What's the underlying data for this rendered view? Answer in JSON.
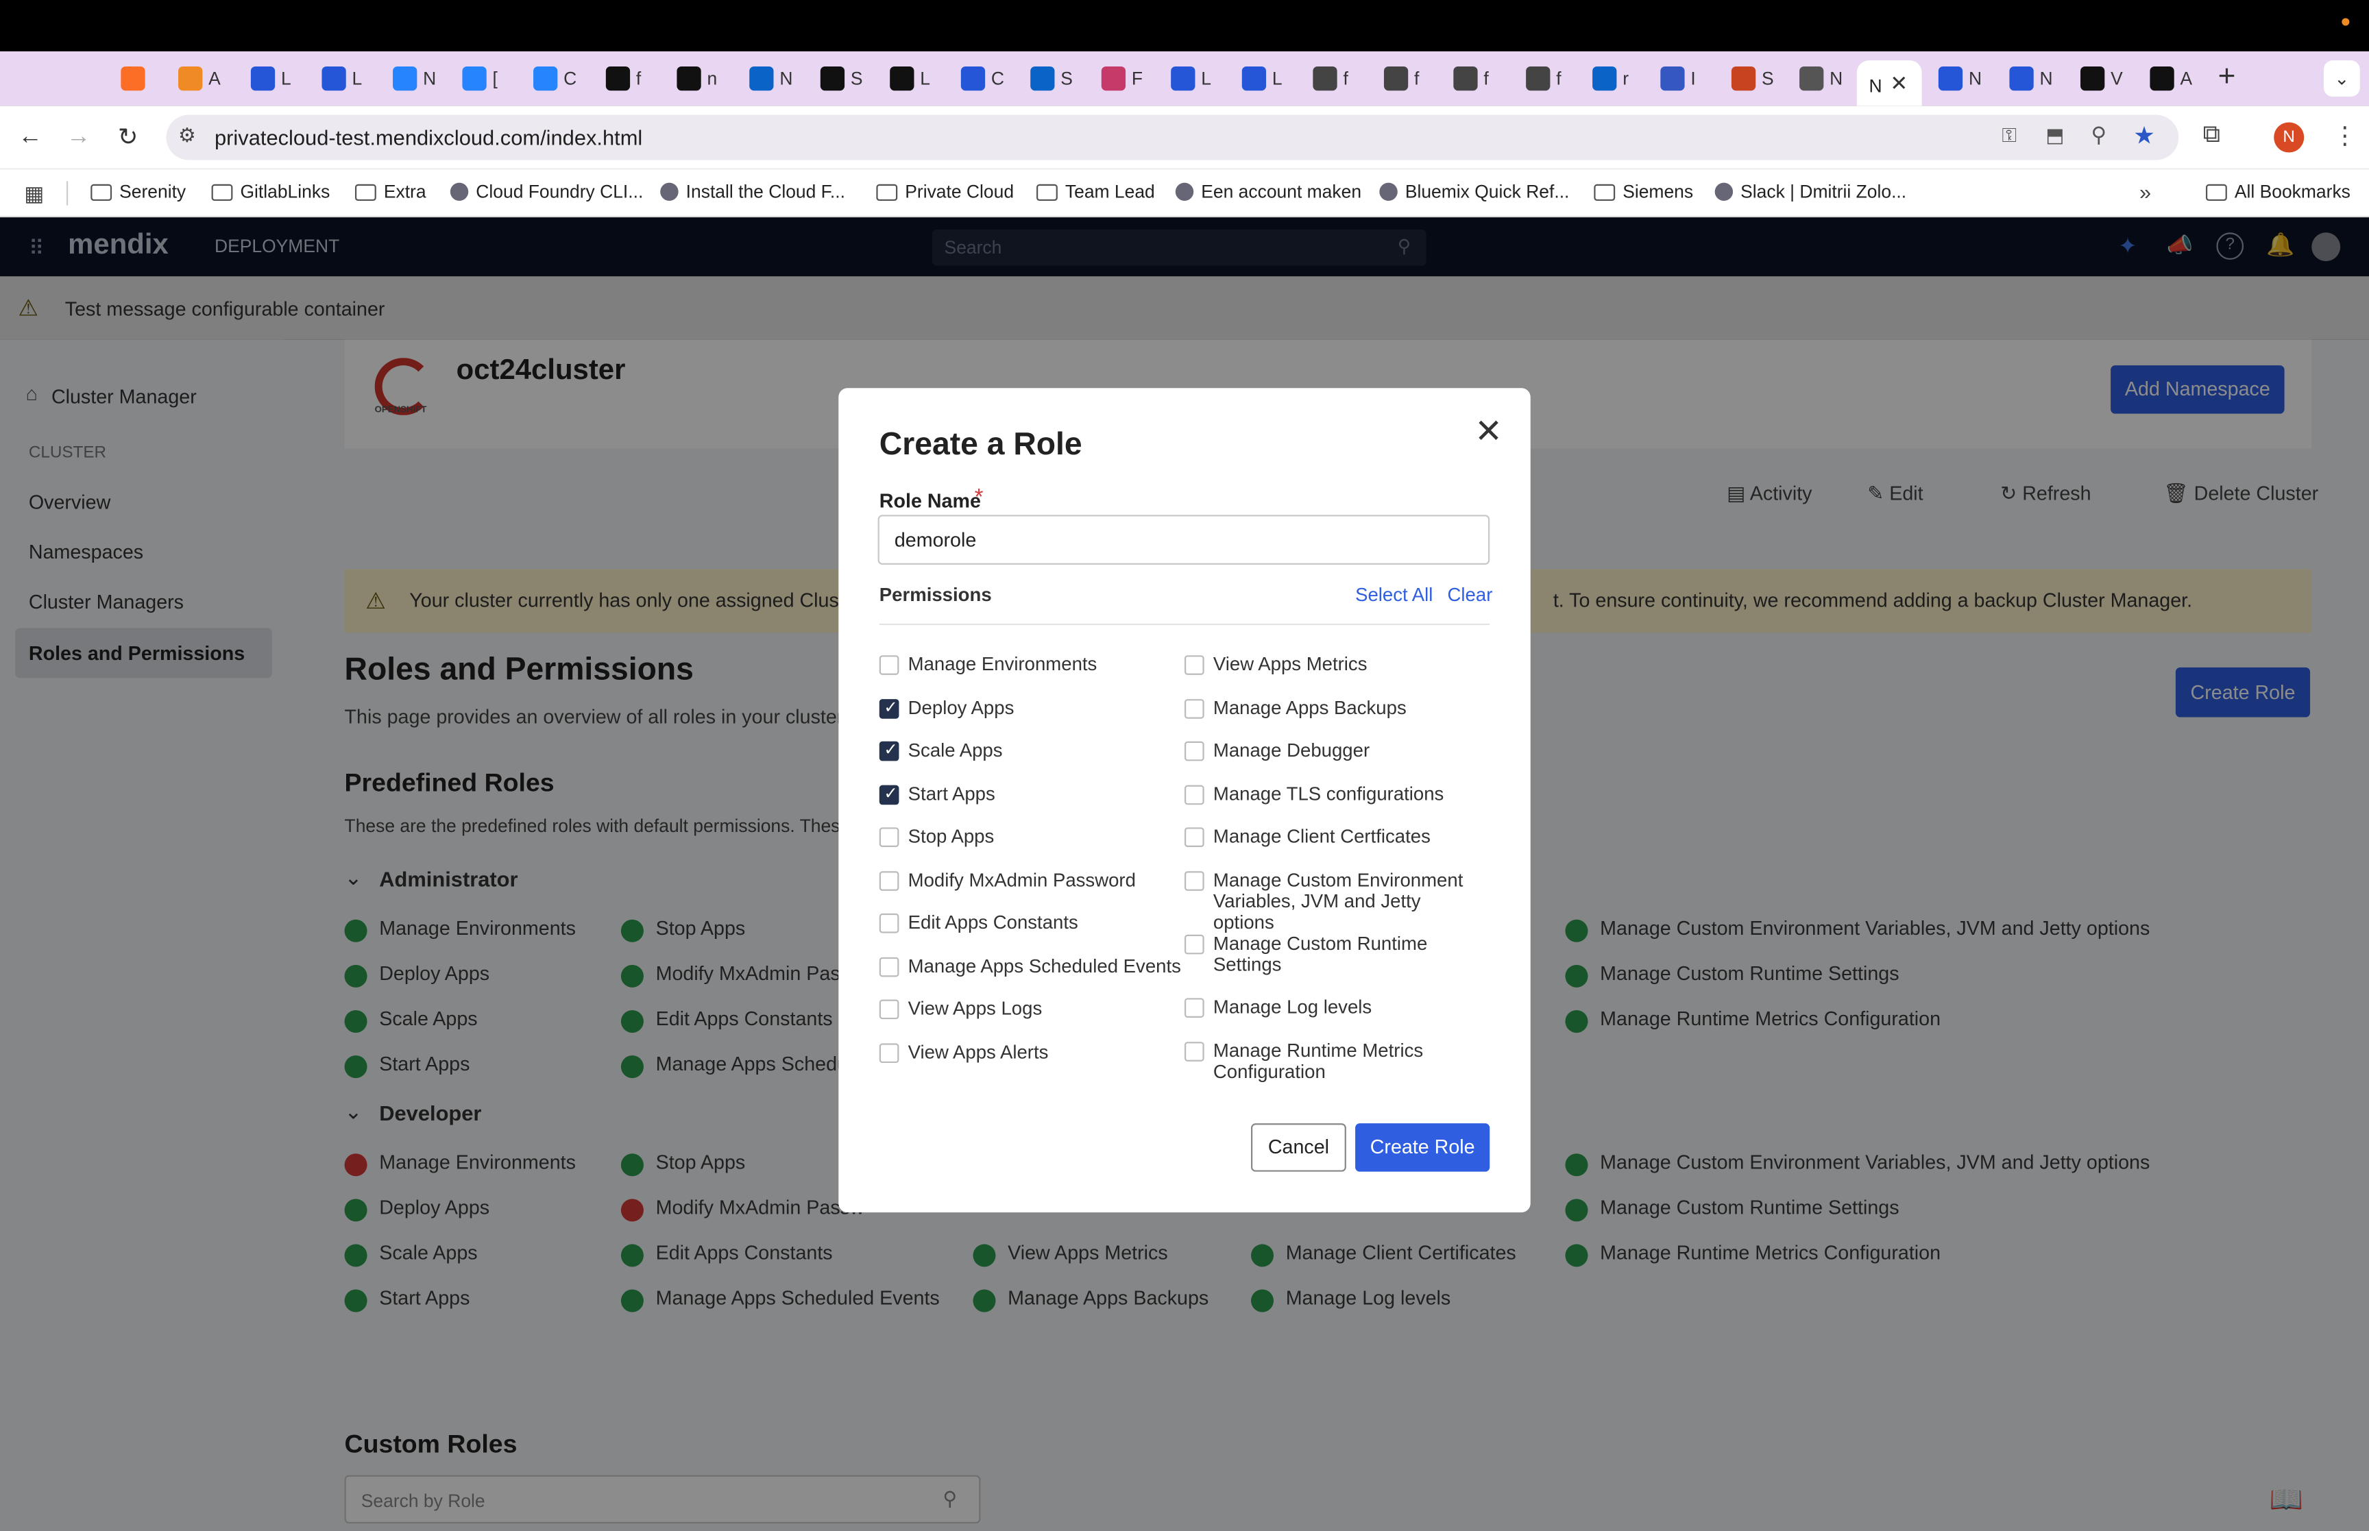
{
  "browser": {
    "url": "privatecloud-test.mendixcloud.com/index.html",
    "tabs": [
      {
        "icon": "gitlab-icon",
        "label": "",
        "color": "#fc6d26"
      },
      {
        "icon": "box-icon",
        "label": "A",
        "color": "#f08a24"
      },
      {
        "icon": "mendix-icon",
        "label": "L",
        "color": "#2556d8"
      },
      {
        "icon": "mendix-icon",
        "label": "L",
        "color": "#2556d8"
      },
      {
        "icon": "jira-icon",
        "label": "N",
        "color": "#2684ff"
      },
      {
        "icon": "jira-icon",
        "label": "[",
        "color": "#2684ff"
      },
      {
        "icon": "jira-icon",
        "label": "C",
        "color": "#2684ff"
      },
      {
        "icon": "terminal-icon",
        "label": "f",
        "color": "#111111"
      },
      {
        "icon": "terminal-icon",
        "label": "n",
        "color": "#111111"
      },
      {
        "icon": "outlook-icon",
        "label": "N",
        "color": "#0a64c8"
      },
      {
        "icon": "github-icon",
        "label": "S",
        "color": "#111111"
      },
      {
        "icon": "github-icon",
        "label": "L",
        "color": "#111111"
      },
      {
        "icon": "mendix-icon",
        "label": "C",
        "color": "#2556d8"
      },
      {
        "icon": "azure-icon",
        "label": "S",
        "color": "#0a64c8"
      },
      {
        "icon": "azure-devops-icon",
        "label": "F",
        "color": "#c63a6a"
      },
      {
        "icon": "mendix-icon",
        "label": "L",
        "color": "#2556d8"
      },
      {
        "icon": "mendix-icon",
        "label": "L",
        "color": "#2556d8"
      },
      {
        "icon": "globe-icon",
        "label": "f",
        "color": "#444444"
      },
      {
        "icon": "globe-icon",
        "label": "f",
        "color": "#444444"
      },
      {
        "icon": "globe-icon",
        "label": "f",
        "color": "#444444"
      },
      {
        "icon": "globe-icon",
        "label": "f",
        "color": "#444444"
      },
      {
        "icon": "azure-icon",
        "label": "r",
        "color": "#0a64c8"
      },
      {
        "icon": "shield-icon",
        "label": "I",
        "color": "#3557c2"
      },
      {
        "icon": "powerpoint-icon",
        "label": "S",
        "color": "#c8431f"
      },
      {
        "icon": "chrome-icon",
        "label": "N",
        "color": "#555555"
      },
      {
        "icon": "mendix-icon",
        "label": "N",
        "color": "#2556d8"
      },
      {
        "icon": "mendix-icon",
        "label": "N",
        "color": "#2556d8"
      },
      {
        "icon": "github-icon",
        "label": "V",
        "color": "#111111"
      },
      {
        "icon": "github-icon",
        "label": "A",
        "color": "#111111"
      }
    ],
    "active_tab_label": "N",
    "bookmarks": [
      {
        "label": "Serenity",
        "icon": "folder-icon"
      },
      {
        "label": "GitlabLinks",
        "icon": "folder-icon"
      },
      {
        "label": "Extra",
        "icon": "folder-icon"
      },
      {
        "label": "Cloud Foundry CLI...",
        "icon": "cloud-foundry-icon"
      },
      {
        "label": "Install the Cloud F...",
        "icon": "ibm-icon"
      },
      {
        "label": "Private Cloud",
        "icon": "folder-icon"
      },
      {
        "label": "Team Lead",
        "icon": "folder-icon"
      },
      {
        "label": "Een account maken",
        "icon": "google-icon"
      },
      {
        "label": "Bluemix Quick Ref...",
        "icon": "github-icon"
      },
      {
        "label": "Siemens",
        "icon": "folder-icon"
      },
      {
        "label": "Slack | Dmitrii Zolo...",
        "icon": "slack-icon"
      }
    ],
    "all_bookmarks": "All Bookmarks",
    "profile_initial": "N"
  },
  "app": {
    "brand": "mendix",
    "section": "DEPLOYMENT",
    "search_placeholder": "Search",
    "message": "Test message configurable container",
    "sidebar": {
      "cluster_manager": "Cluster Manager",
      "section_label": "CLUSTER",
      "items": [
        "Overview",
        "Namespaces",
        "Cluster Managers",
        "Roles and Permissions"
      ]
    },
    "cluster_name": "oct24cluster",
    "openshift_label": "OPENSHIFT",
    "add_namespace": "Add Namespace",
    "actions": [
      "Activity",
      "Edit",
      "Refresh",
      "Delete Cluster"
    ],
    "warning_left": "Your cluster currently has only one assigned Cluster M",
    "warning_right": "t. To ensure continuity, we recommend adding a backup Cluster Manager.",
    "roles_title": "Roles and Permissions",
    "roles_desc": "This page provides an overview of all roles in your cluster, inc",
    "create_role": "Create Role",
    "predefined_title": "Predefined Roles",
    "predefined_desc": "These are the predefined roles with default permissions. Thes",
    "administrator": {
      "title": "Administrator",
      "col1": [
        "Manage Environments",
        "Deploy Apps",
        "Scale Apps",
        "Start Apps"
      ],
      "col2": [
        "Stop Apps",
        "Modify MxAdmin Passw",
        "Edit Apps Constants",
        "Manage Apps Schedul"
      ],
      "col5": [
        "Manage Custom Environment Variables, JVM and Jetty options",
        "Manage Custom Runtime Settings",
        "Manage Runtime Metrics Configuration"
      ]
    },
    "developer": {
      "title": "Developer",
      "col1": [
        "Manage Environments",
        "Deploy Apps",
        "Scale Apps",
        "Start Apps"
      ],
      "col1_state": [
        false,
        true,
        true,
        true
      ],
      "col2": [
        "Stop Apps",
        "Modify MxAdmin Passw",
        "Edit Apps Constants",
        "Manage Apps Scheduled Events"
      ],
      "col2_state": [
        true,
        false,
        true,
        true
      ],
      "col3": [
        "View Apps Metrics",
        "Manage Apps Backups"
      ],
      "col4": [
        "Manage Client Certificates",
        "Manage Log levels"
      ],
      "col5": [
        "Manage Custom Environment Variables, JVM and Jetty options",
        "Manage Custom Runtime Settings",
        "Manage Runtime Metrics Configuration"
      ]
    },
    "custom_title": "Custom Roles",
    "custom_search_placeholder": "Search by Role"
  },
  "modal": {
    "title": "Create a Role",
    "role_name_label": "Role Name",
    "required_mark": "*",
    "role_name_value": "demorole",
    "permissions_label": "Permissions",
    "select_all": "Select All",
    "clear": "Clear",
    "left_permissions": [
      {
        "label": "Manage Environments",
        "checked": false
      },
      {
        "label": "Deploy Apps",
        "checked": true
      },
      {
        "label": "Scale Apps",
        "checked": true
      },
      {
        "label": "Start Apps",
        "checked": true
      },
      {
        "label": "Stop Apps",
        "checked": false
      },
      {
        "label": "Modify MxAdmin Password",
        "checked": false
      },
      {
        "label": "Edit Apps Constants",
        "checked": false
      },
      {
        "label": "Manage Apps Scheduled Events",
        "checked": false
      },
      {
        "label": "View Apps Logs",
        "checked": false
      },
      {
        "label": "View Apps Alerts",
        "checked": false
      }
    ],
    "right_permissions": [
      {
        "label": "View Apps Metrics",
        "checked": false
      },
      {
        "label": "Manage Apps Backups",
        "checked": false
      },
      {
        "label": "Manage Debugger",
        "checked": false
      },
      {
        "label": "Manage TLS configurations",
        "checked": false
      },
      {
        "label": "Manage Client Certficates",
        "checked": false
      },
      {
        "label": "Manage Custom Environment Variables, JVM and Jetty options",
        "checked": false
      },
      {
        "label": "Manage Custom Runtime Settings",
        "checked": false
      },
      {
        "label": "Manage Log levels",
        "checked": false
      },
      {
        "label": "Manage Runtime Metrics Configuration",
        "checked": false
      }
    ],
    "cancel": "Cancel",
    "create": "Create Role"
  },
  "colors": {
    "primary": "#2f5fe0",
    "navy": "#0a1325",
    "success": "#2d9b4e",
    "danger": "#d53a3a",
    "tab_strip": "#e9d6f2"
  }
}
